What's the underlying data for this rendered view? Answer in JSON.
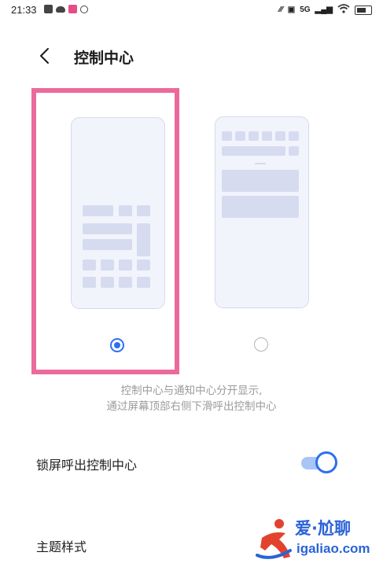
{
  "status_bar": {
    "time": "21:33",
    "network_label": "5G"
  },
  "header": {
    "title": "控制中心",
    "back_icon": "chevron-left-icon"
  },
  "layout_options": [
    {
      "id": "separate",
      "selected": true
    },
    {
      "id": "combined",
      "selected": false
    }
  ],
  "description": {
    "line1": "控制中心与通知中心分开显示,",
    "line2": "通过屏幕顶部右侧下滑呼出控制中心"
  },
  "settings": {
    "lockscreen": {
      "label": "锁屏呼出控制中心",
      "enabled": true
    },
    "theme": {
      "label": "主题样式"
    }
  },
  "watermark": {
    "brand": "爱·尬聊",
    "domain": "igaliao.com"
  },
  "colors": {
    "accent": "#2e6ff0",
    "highlight_border": "#ec6a9b",
    "mock_block": "#d6dbf0",
    "description_text": "#9b9b9b",
    "watermark": "#2b63d6"
  }
}
